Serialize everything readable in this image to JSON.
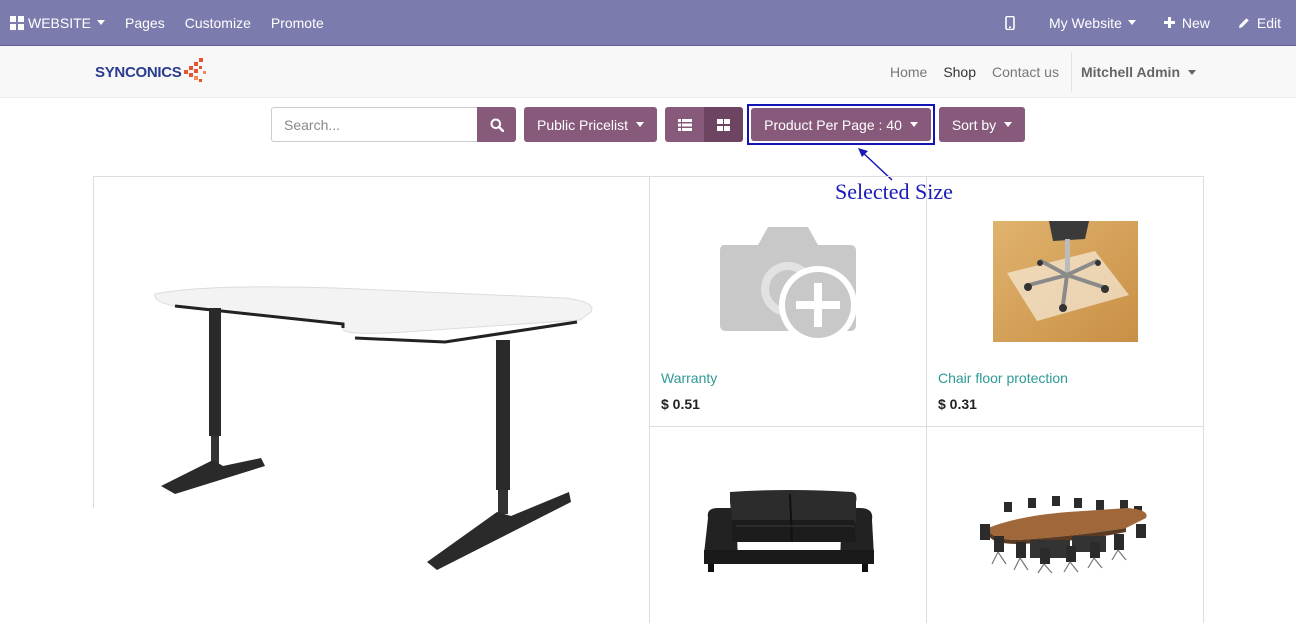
{
  "adminbar": {
    "website_label": "WEBSITE",
    "pages_label": "Pages",
    "customize_label": "Customize",
    "promote_label": "Promote",
    "my_website_label": "My Website",
    "new_label": "New",
    "edit_label": "Edit"
  },
  "header": {
    "logo_text": "SYNCONICS",
    "nav": {
      "home": "Home",
      "shop": "Shop",
      "contact": "Contact us"
    },
    "user_label": "Mitchell Admin"
  },
  "toolbar": {
    "search_placeholder": "Search...",
    "pricelist_label": "Public Pricelist",
    "products_per_page_label": "Product Per Page : 40",
    "sort_label": "Sort by"
  },
  "annotation": {
    "text": "Selected Size"
  },
  "products": [
    {
      "name": "Warranty",
      "price": "$ 0.51",
      "icon": "camera-plus-placeholder-icon"
    },
    {
      "name": "Chair floor protection",
      "price": "$ 0.31",
      "icon": "chair-mat-image"
    }
  ],
  "colors": {
    "adminbar": "#7c7bad",
    "button": "#875a7b",
    "link": "#2e9a96",
    "annotation": "#1a1ab8"
  }
}
